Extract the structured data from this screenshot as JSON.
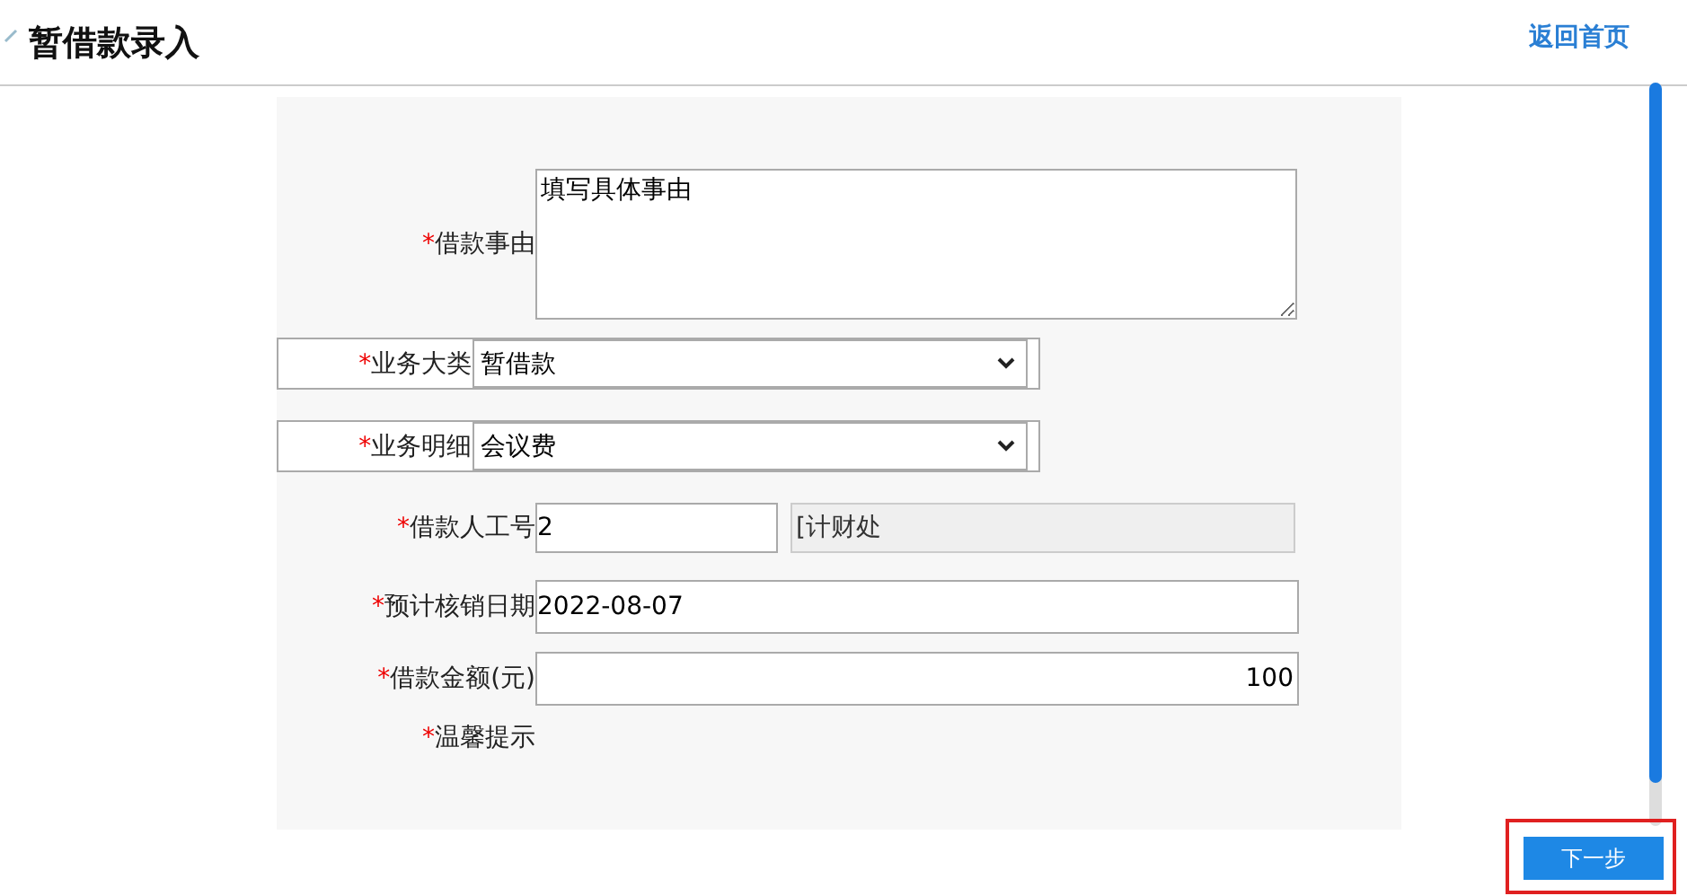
{
  "header": {
    "title": "暂借款录入",
    "home_link": "返回首页"
  },
  "form": {
    "fields": [
      {
        "kind": "textarea",
        "label": "借款事由",
        "required": "*",
        "value": "填写具体事由"
      },
      {
        "kind": "select",
        "label": "业务大类",
        "required": "*",
        "value": "暂借款"
      },
      {
        "kind": "select",
        "label": "业务明细",
        "required": "*",
        "value": "会议费"
      },
      {
        "kind": "id",
        "label": "借款人工号",
        "required": "*",
        "value": "2",
        "department": "[计财处"
      },
      {
        "kind": "text",
        "label": "预计核销日期",
        "required": "*",
        "value": "2022-08-07"
      },
      {
        "kind": "amount",
        "label": "借款金额(元)",
        "required": "*",
        "value": "100"
      },
      {
        "kind": "note",
        "label": "温馨提示",
        "required": "*"
      }
    ]
  },
  "next_button": "下一步"
}
